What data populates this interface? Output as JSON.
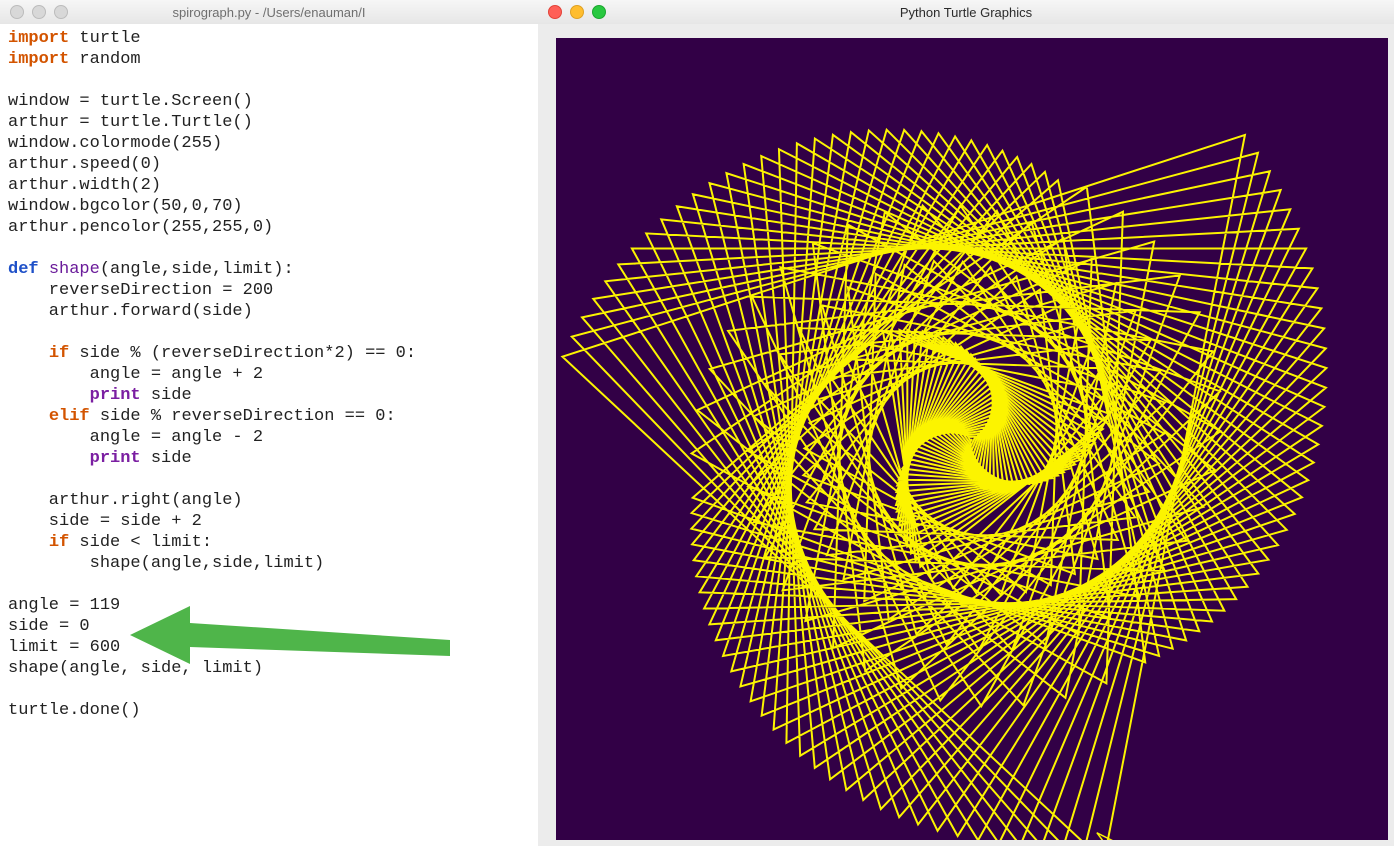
{
  "editor": {
    "title": "spirograph.py - /Users/enauman/I",
    "tokens": {
      "import": "import",
      "def": "def",
      "if": "if",
      "elif": "elif",
      "print": "print",
      "mod_turtle": " turtle",
      "mod_random": " random",
      "l_window_screen": "window = turtle.Screen()",
      "l_arthur_turtle": "arthur = turtle.Turtle()",
      "l_colormode": "window.colormode(255)",
      "l_speed": "arthur.speed(0)",
      "l_width": "arthur.width(2)",
      "l_bgcolor": "window.bgcolor(50,0,70)",
      "l_pencolor": "arthur.pencolor(255,255,0)",
      "fn_shape": "shape",
      "params": "(angle,side,limit):",
      "l_reverse": "    reverseDirection = 200",
      "l_forward": "    arthur.forward(side)",
      "l_if_cond": " side % (reverseDirection*2) == 0:",
      "l_angle_plus": "        angle = angle + 2",
      "l_print_side": " side",
      "l_elif_cond": " side % reverseDirection == 0:",
      "l_angle_minus": "        angle = angle - 2",
      "l_right": "    arthur.right(angle)",
      "l_side_incr": "    side = side + 2",
      "l_if_limit": " side < limit:",
      "l_recurse": "        shape(angle,side,limit)",
      "l_angle_set": "angle = 119",
      "l_side_set": "side = 0",
      "l_limit_set": "limit = 600",
      "l_shape_call": "shape(angle, side, limit)",
      "l_done": "turtle.done()"
    }
  },
  "graphics": {
    "title": "Python Turtle Graphics",
    "bgcolor": "#320046",
    "pencolor": "#fcf400",
    "angle": 119,
    "side_start": 0,
    "side_step": 2,
    "limit": 600,
    "reverseDirection": 200
  },
  "annotation": {
    "arrow_color": "#4fb54a"
  }
}
